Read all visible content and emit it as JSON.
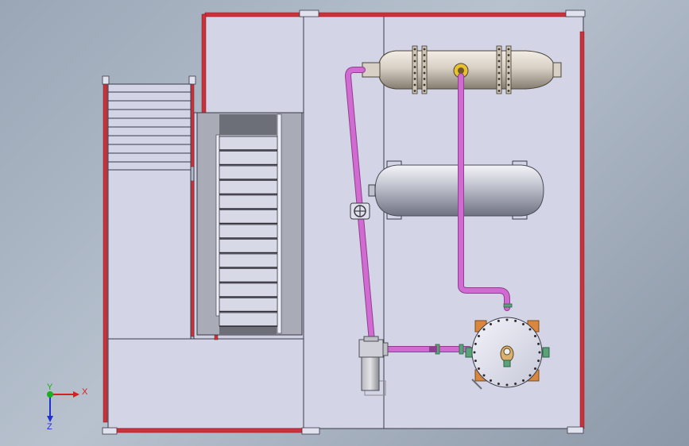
{
  "viewport": {
    "background_colors": [
      "#9aa6b6",
      "#b8c2cf",
      "#8c97a7"
    ],
    "view": "top"
  },
  "colors": {
    "floor": "#d3d5e6",
    "floor_stroke": "#3a3a48",
    "rail_red": "#c8323a",
    "pipe": "#d16ad1",
    "pipe_dark": "#8f3f8f",
    "tank": "#c9cbd6",
    "exchanger": "#d8d0c4",
    "stair_dark": "#6d6f78",
    "orange": "#d9873d",
    "yellow": "#e8c030"
  },
  "components": {
    "platform": "platform",
    "staircase_left": "staircase",
    "staircase_center": "staircase",
    "heat_exchanger": "heat-exchanger",
    "storage_tank": "horizontal-tank",
    "reactor": "vertical-vessel",
    "pump": "pump",
    "valve": "valve"
  },
  "triad": {
    "x_label": "X",
    "y_label": "Y",
    "z_label": "Z",
    "x_color": "#d62020",
    "y_color": "#19b019",
    "z_color": "#2030d0"
  }
}
